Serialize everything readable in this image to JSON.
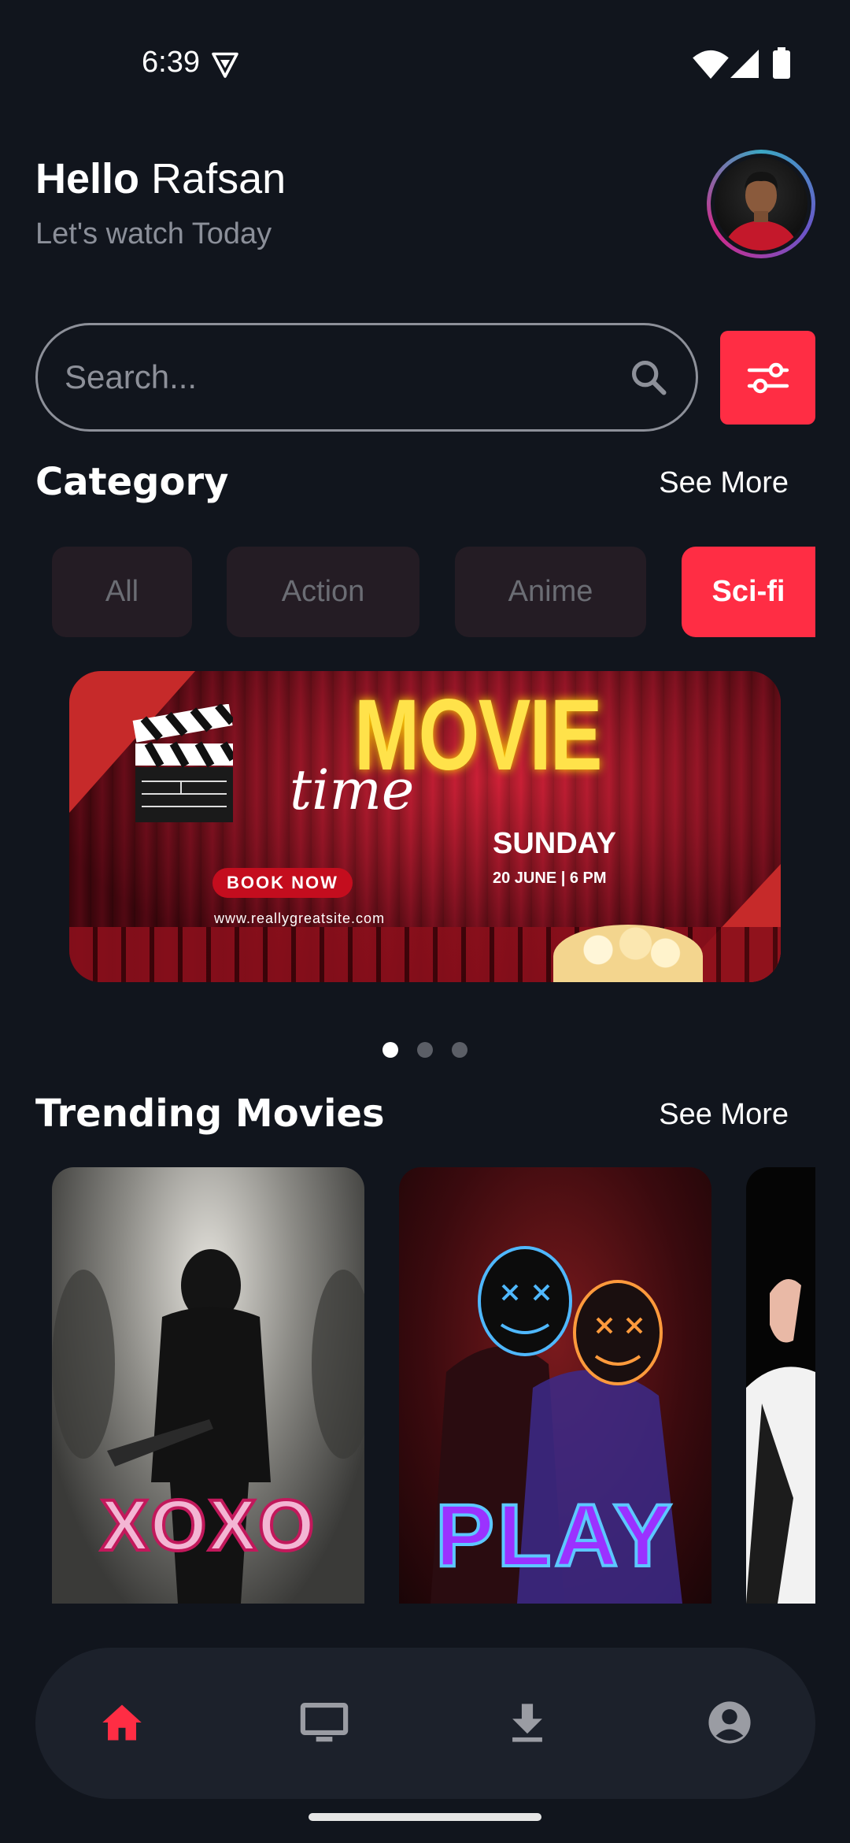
{
  "status_bar": {
    "time": "6:39"
  },
  "header": {
    "greeting_bold": "Hello",
    "user_name": "Rafsan",
    "subtitle": "Let's watch Today"
  },
  "search": {
    "placeholder": "Search..."
  },
  "category": {
    "title": "Category",
    "see_more": "See More",
    "chips": [
      "All",
      "Action",
      "Anime",
      "Sci-fi"
    ],
    "active_chip": "Sci-fi"
  },
  "banner": {
    "headline": "MOVIE",
    "script_word": "time",
    "day": "SUNDAY",
    "date_time": "20 JUNE | 6 PM",
    "cta": "BOOK NOW",
    "url": "www.reallygreatsite.com"
  },
  "carousel": {
    "page_count": 3,
    "active_index": 0
  },
  "trending": {
    "title": "Trending Movies",
    "see_more": "See More",
    "movies": [
      {
        "poster_text": "XOXO"
      },
      {
        "poster_text": "PLAY"
      },
      {
        "poster_text": ""
      }
    ]
  },
  "bottom_nav": {
    "items": [
      "home-icon",
      "tv-icon",
      "download-icon",
      "profile-icon"
    ],
    "active": "home-icon"
  },
  "colors": {
    "accent": "#ff2d44",
    "background": "#11151d",
    "nav_bg": "#1c212b",
    "chip_bg": "#241c24"
  }
}
